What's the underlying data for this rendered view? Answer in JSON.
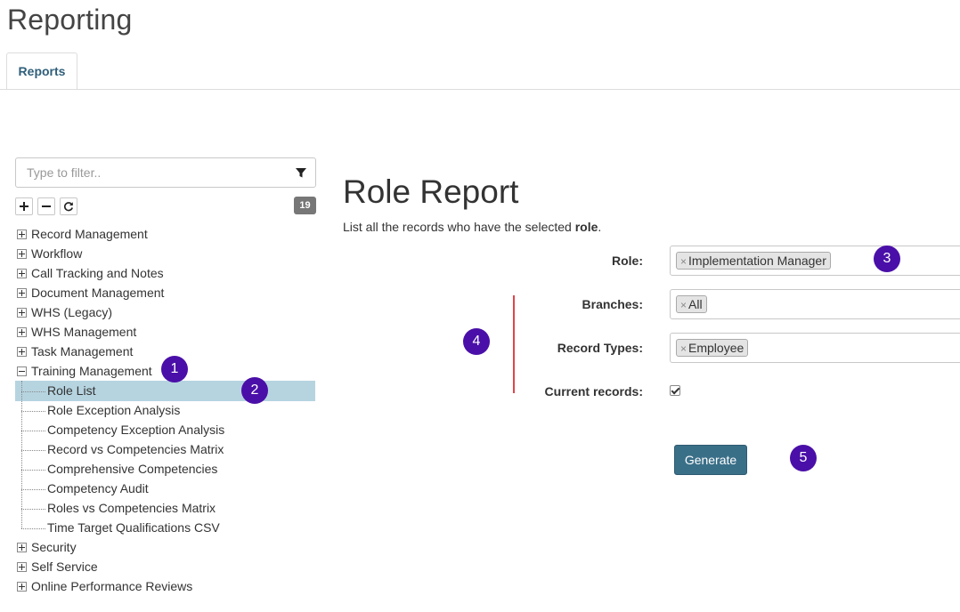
{
  "app": {
    "title": "Reporting"
  },
  "tabs": [
    {
      "label": "Reports",
      "active": true
    }
  ],
  "sidebar": {
    "filter_placeholder": "Type to filter..",
    "count_badge": "19",
    "tree": [
      {
        "label": "Record Management",
        "expanded": false
      },
      {
        "label": "Workflow",
        "expanded": false
      },
      {
        "label": "Call Tracking and Notes",
        "expanded": false
      },
      {
        "label": "Document Management",
        "expanded": false
      },
      {
        "label": "WHS (Legacy)",
        "expanded": false
      },
      {
        "label": "WHS Management",
        "expanded": false
      },
      {
        "label": "Task Management",
        "expanded": false
      },
      {
        "label": "Training Management",
        "expanded": true,
        "children": [
          {
            "label": "Role List",
            "selected": true
          },
          {
            "label": "Role Exception Analysis"
          },
          {
            "label": "Competency Exception Analysis"
          },
          {
            "label": "Record vs Competencies Matrix"
          },
          {
            "label": "Comprehensive Competencies"
          },
          {
            "label": "Competency Audit"
          },
          {
            "label": "Roles vs Competencies Matrix"
          },
          {
            "label": "Time Target Qualifications CSV"
          }
        ]
      },
      {
        "label": "Security",
        "expanded": false
      },
      {
        "label": "Self Service",
        "expanded": false
      },
      {
        "label": "Online Performance Reviews",
        "expanded": false
      }
    ]
  },
  "report": {
    "title": "Role Report",
    "description_prefix": "List all the records who have the selected ",
    "description_bold": "role",
    "description_suffix": ".",
    "role_label": "Role:",
    "role_chip": "Implementation Manager",
    "branches_label": "Branches:",
    "branches_chip": "All",
    "record_types_label": "Record Types:",
    "record_types_chip": "Employee",
    "current_records_label": "Current records:",
    "current_records_checked": true,
    "generate_label": "Generate",
    "chip_remove_glyph": "×"
  },
  "callouts": [
    "1",
    "2",
    "3",
    "4",
    "5"
  ],
  "colors": {
    "accent": "#3a6f88",
    "selected_row": "#b6d4e0",
    "callout": "#4a0fa8",
    "divider_red": "#e0454a"
  }
}
